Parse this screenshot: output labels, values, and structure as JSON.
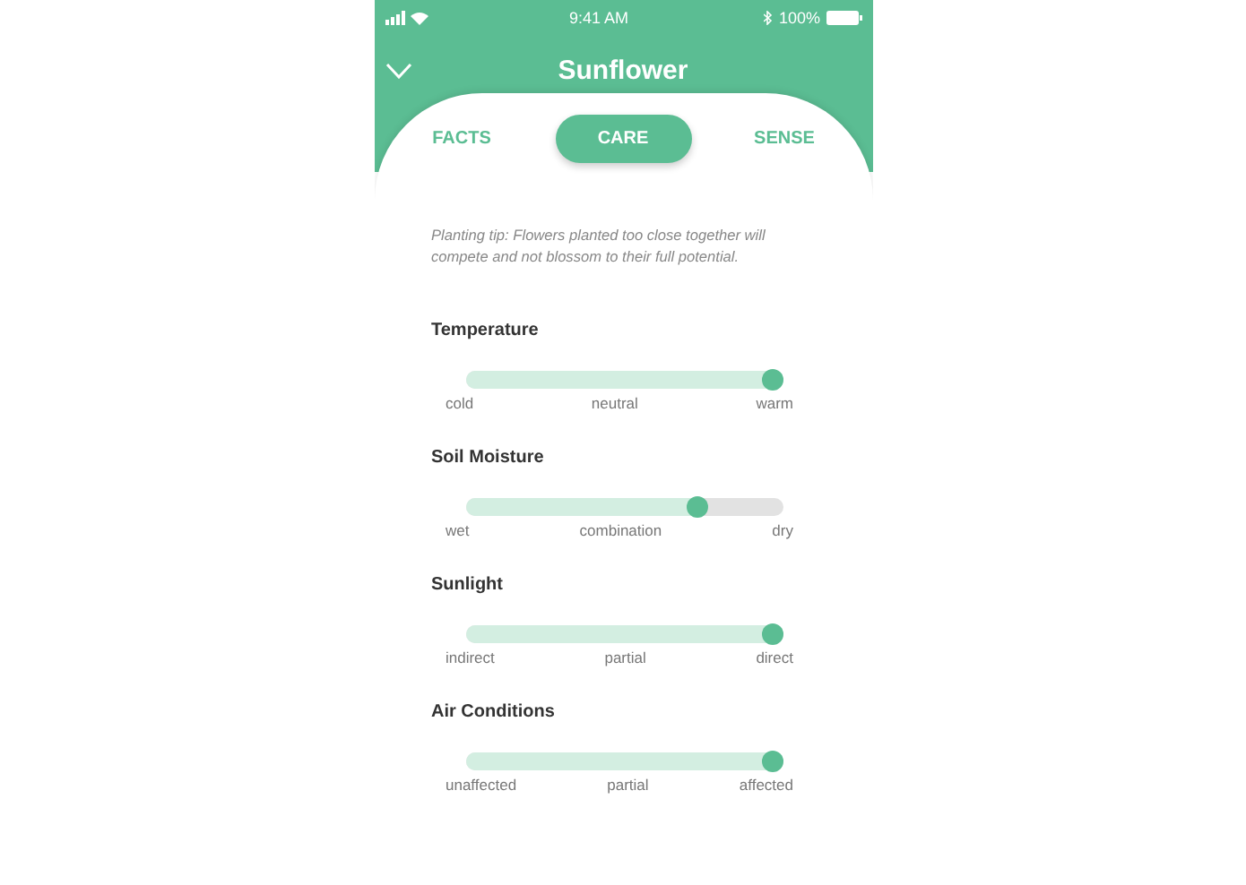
{
  "status_bar": {
    "time": "9:41 AM",
    "battery": "100%"
  },
  "header": {
    "title": "Sunflower"
  },
  "tabs": [
    {
      "label": "FACTS",
      "selected": false
    },
    {
      "label": "CARE",
      "selected": true
    },
    {
      "label": "SENSE",
      "selected": false
    }
  ],
  "tip": "Planting tip: Flowers planted too close together will compete and not blossom to their full potential.",
  "sliders": [
    {
      "name": "Temperature",
      "level": 1,
      "labels": [
        "cold",
        "neutral",
        "warm"
      ]
    },
    {
      "name": "Soil Moisture",
      "level": 0.76,
      "labels": [
        "wet",
        "combination",
        "dry"
      ]
    },
    {
      "name": "Sunlight",
      "level": 1,
      "labels": [
        "indirect",
        "partial",
        "direct"
      ]
    },
    {
      "name": "Air Conditions",
      "level": 1,
      "labels": [
        "unaffected",
        "partial",
        "affected"
      ]
    }
  ]
}
